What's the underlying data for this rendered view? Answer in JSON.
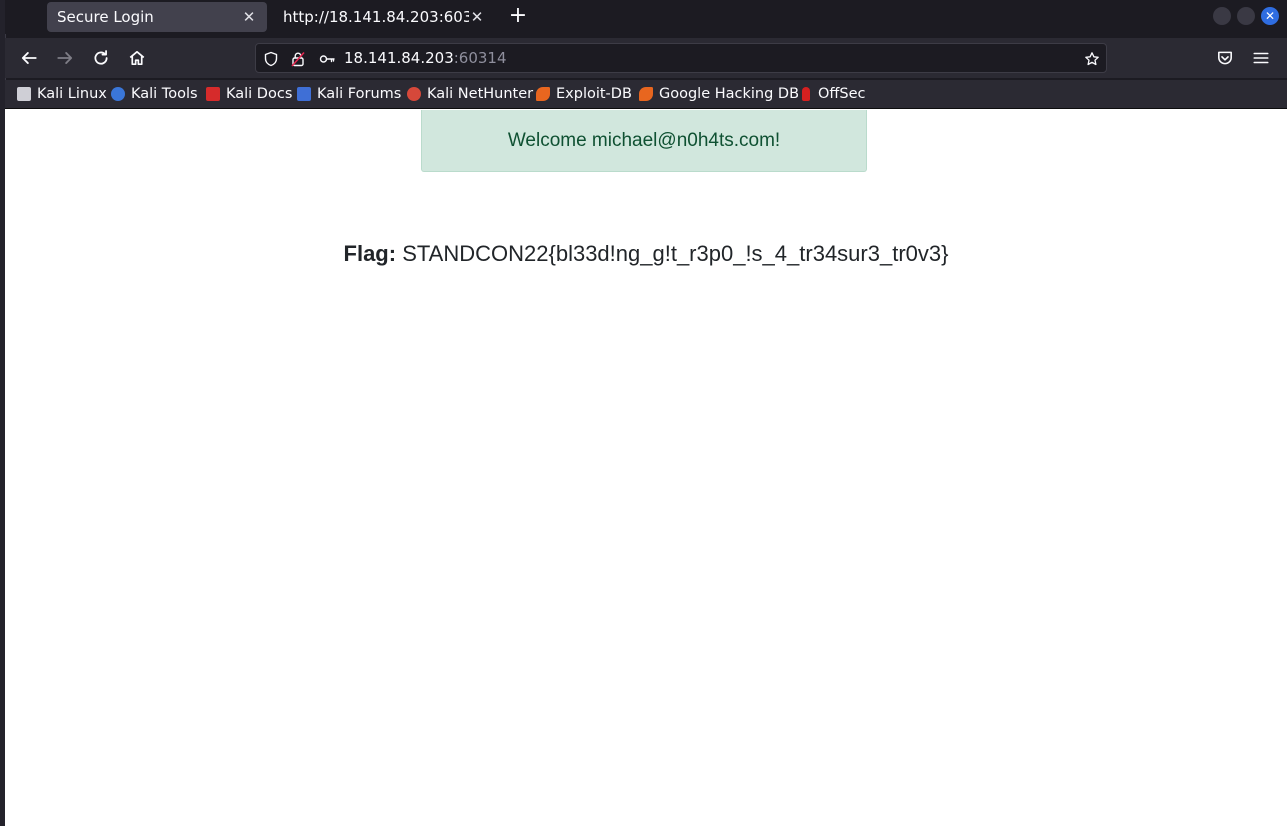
{
  "browser": {
    "tabs": [
      {
        "title": "Secure Login",
        "active": true
      },
      {
        "title": "http://18.141.84.203:60314/",
        "active": false
      }
    ],
    "url": {
      "host": "18.141.84.203",
      "port": ":60314"
    },
    "bookmarks": [
      {
        "label": "Kali Linux",
        "icon": "kali-dragon-icon",
        "color": "#cfcfd6"
      },
      {
        "label": "Kali Tools",
        "icon": "kali-tools-icon",
        "color": "#3a76d8"
      },
      {
        "label": "Kali Docs",
        "icon": "kali-docs-icon",
        "color": "#d62b2b"
      },
      {
        "label": "Kali Forums",
        "icon": "kali-forums-icon",
        "color": "#3f6fd6"
      },
      {
        "label": "Kali NetHunter",
        "icon": "nethunter-icon",
        "color": "#d6483a"
      },
      {
        "label": "Exploit-DB",
        "icon": "exploit-db-icon",
        "color": "#e8661f"
      },
      {
        "label": "Google Hacking DB",
        "icon": "ghdb-icon",
        "color": "#e8661f"
      },
      {
        "label": "OffSec",
        "icon": "offsec-icon",
        "color": "#d62020"
      }
    ]
  },
  "page": {
    "welcome": "Welcome michael@n0h4ts.com!",
    "flag_label": "Flag:",
    "flag_value": "STANDCON22{bl33d!ng_g!t_r3p0_!s_4_tr34sur3_tr0v3}"
  }
}
